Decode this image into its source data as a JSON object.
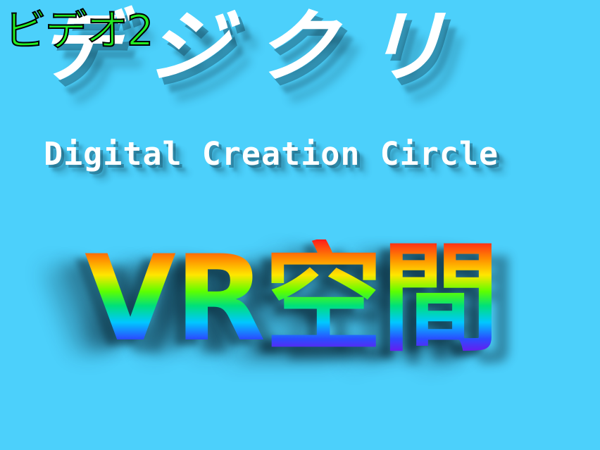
{
  "corner_label": "ビデオ2",
  "logo_text": "デジクリ",
  "subtitle": "Digital Creation Circle",
  "heading": "VR空間",
  "colors": {
    "background": "#4cd0fb",
    "logo": "#ffffff",
    "corner_label": "#22ee22"
  }
}
